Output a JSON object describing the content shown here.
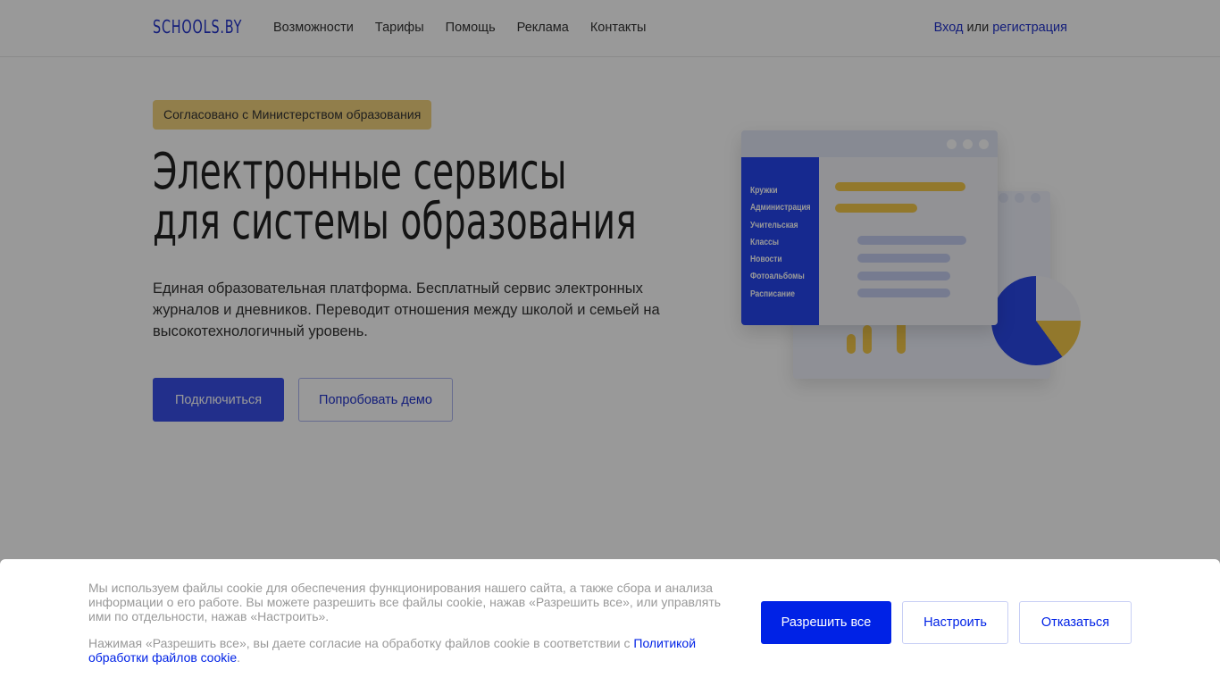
{
  "header": {
    "logo": "SCHOOLS.BY",
    "nav": [
      "Возможности",
      "Тарифы",
      "Помощь",
      "Реклама",
      "Контакты"
    ],
    "login": "Вход",
    "or": " или ",
    "register": "регистрация"
  },
  "hero": {
    "badge": "Согласовано с Министерством образования",
    "title_line1": "Электронные сервисы",
    "title_line2": "для системы образования",
    "description": "Единая образовательная платформа. Бесплатный сервис электронных журналов и дневников. Переводит отношения между школой и семьей на высокотехнологичный уровень.",
    "connect_button": "Подключиться",
    "demo_button": "Попробовать демо",
    "illustration_menu": [
      "Кружки",
      "Администрация",
      "Учительская",
      "Классы",
      "Новости",
      "Фотоальбомы",
      "Расписание"
    ]
  },
  "cookie": {
    "text1": "Мы используем файлы cookie для обеспечения функционирования нашего сайта, а также сбора и анализа информации о его работе. Вы можете разрешить все файлы cookie, нажав «Разрешить все», или управлять ими по отдельности, нажав «Настроить».",
    "text2": "Нажимая «Разрешить все», вы даете согласие на обработку файлов cookie в соответствии с ",
    "policy_link": "Политикой обработки файлов cookie",
    "period": ".",
    "allow_all": "Разрешить все",
    "configure": "Настроить",
    "decline": "Отказаться"
  },
  "colors": {
    "accent": "#0022e6",
    "badge": "#f2d27e"
  }
}
